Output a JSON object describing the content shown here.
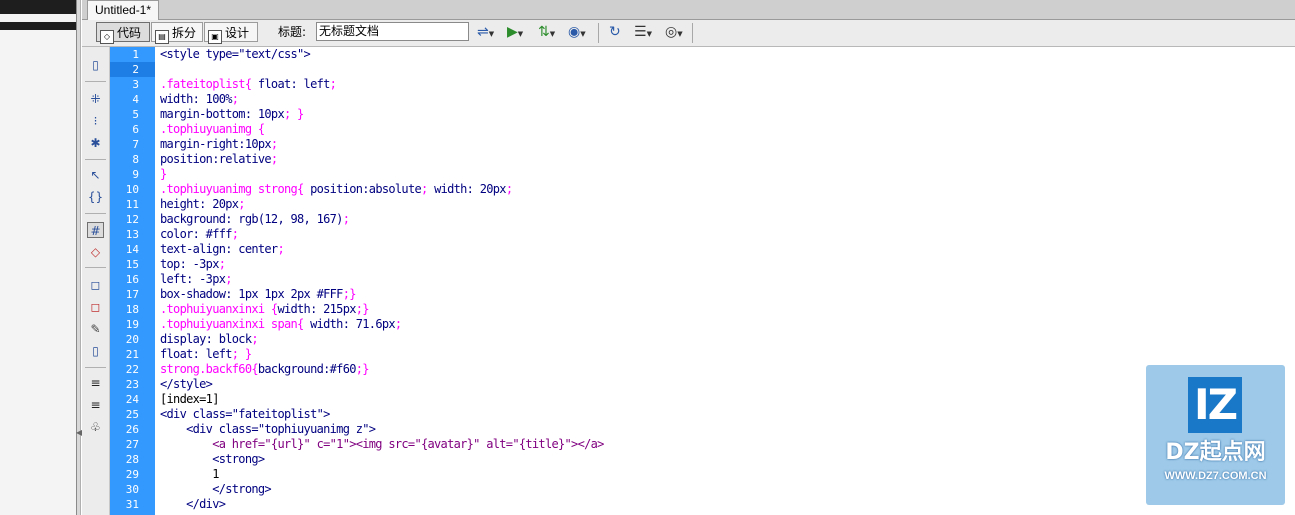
{
  "document": {
    "tab_title": "Untitled-1*"
  },
  "toolbar": {
    "view_code": "代码",
    "view_split": "拆分",
    "view_design": "设计",
    "title_label": "标题:",
    "title_value": "无标题文档",
    "icons": [
      "file-management-icon",
      "preview-browser-icon",
      "debug-icon",
      "visual-aids-icon",
      "refresh-icon",
      "view-options-icon",
      "visual-aids-eye-icon"
    ]
  },
  "editor": {
    "line_numbers": [
      "1",
      "2",
      "3",
      "4",
      "5",
      "6",
      "7",
      "8",
      "9",
      "10",
      "11",
      "12",
      "13",
      "14",
      "15",
      "16",
      "17",
      "18",
      "19",
      "20",
      "21",
      "22",
      "23",
      "24",
      "25",
      "26",
      "27",
      "28",
      "29",
      "30",
      "31"
    ],
    "colors": {
      "gutter": "#3399ff",
      "selector": "#ff00ff",
      "tag": "#000080",
      "string": "#0000ff"
    }
  },
  "watermark": {
    "logo_text": "IZ",
    "name": "DZ起点网",
    "url": "WWW.DZ7.COM.CN"
  }
}
